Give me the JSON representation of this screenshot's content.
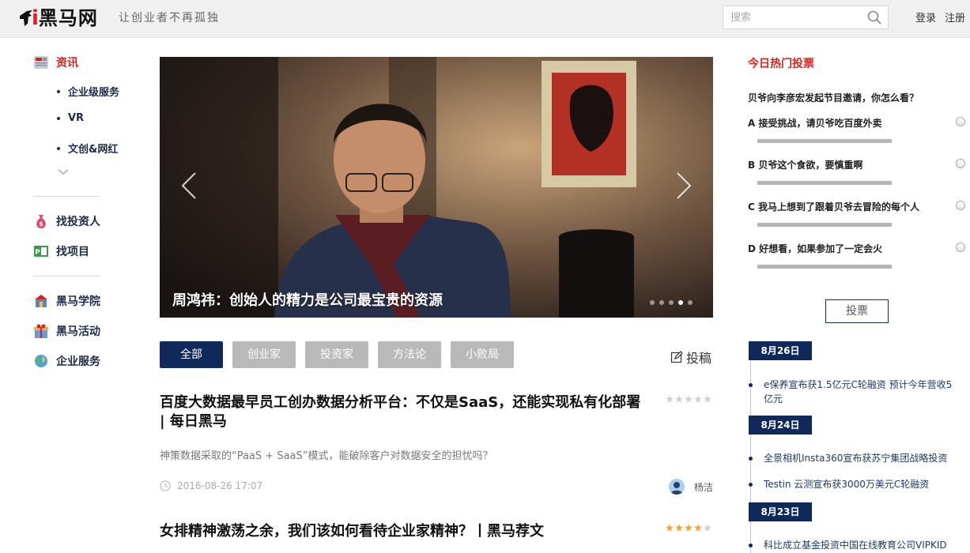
{
  "header": {
    "logo_letter": "i",
    "logo_text": "黑马网",
    "slogan": "让创业者不再孤独",
    "search_placeholder": "搜索",
    "login": "登录",
    "register": "注册"
  },
  "sidebar": {
    "main": [
      {
        "label": "资讯",
        "icon": "news-icon"
      }
    ],
    "sub": [
      "企业级服务",
      "VR",
      "文创&网红"
    ],
    "more_icon": "chevron-down-icon",
    "group2": [
      {
        "label": "找投资人",
        "icon": "money-bag-icon"
      },
      {
        "label": "找项目",
        "icon": "project-icon"
      }
    ],
    "group3": [
      {
        "label": "黑马学院",
        "icon": "school-icon"
      },
      {
        "label": "黑马活动",
        "icon": "gift-icon"
      },
      {
        "label": "企业服务",
        "icon": "globe-icon"
      }
    ]
  },
  "banner": {
    "caption": "周鸿祎：创始人的精力是公司最宝贵的资源",
    "slide_count": 5,
    "active_slide": 4
  },
  "tabs": [
    {
      "label": "全部",
      "active": true
    },
    {
      "label": "创业家",
      "active": false
    },
    {
      "label": "投资家",
      "active": false
    },
    {
      "label": "方法论",
      "active": false
    },
    {
      "label": "小败局",
      "active": false
    }
  ],
  "post_label": "投稿",
  "articles": [
    {
      "title": "百度大数据最早员工创办数据分析平台：不仅是SaaS，还能实现私有化部署 | 每日黑马",
      "desc": "神策数据采取的“PaaS + SaaS”模式，能破除客户对数据安全的担忧吗？",
      "time": "2016-08-26 17:07",
      "author": "杨洁",
      "stars": 0
    },
    {
      "title": "女排精神激荡之余，我们该如何看待企业家精神？丨黑马荐文",
      "stars": 4
    }
  ],
  "vote": {
    "heading": "今日热门投票",
    "question": "贝爷向李彦宏发起节目邀请，你怎么看？",
    "options": [
      "A 接受挑战，请贝爷吃百度外卖",
      "B 贝爷这个食欲，要慎重啊",
      "C 我马上想到了跟着贝爷去冒险的每个人",
      "D 好想看，如果参加了一定会火"
    ],
    "button": "投票"
  },
  "timeline": [
    {
      "date": "8月26日",
      "items": [
        "e保养宣布获1.5亿元C轮融资 预计今年营收5亿元"
      ]
    },
    {
      "date": "8月24日",
      "items": [
        "全景相机Insta360宣布获苏宁集团战略投资",
        "Testin 云测宣布获3000万美元C轮融资"
      ]
    },
    {
      "date": "8月23日",
      "items": [
        "科比成立基金投资中国在线教育公司VIPKID"
      ]
    }
  ],
  "colors": {
    "accent_red": "#d8221e",
    "navy": "#0f2a5a",
    "tab_gray": "#b9b9b9"
  }
}
